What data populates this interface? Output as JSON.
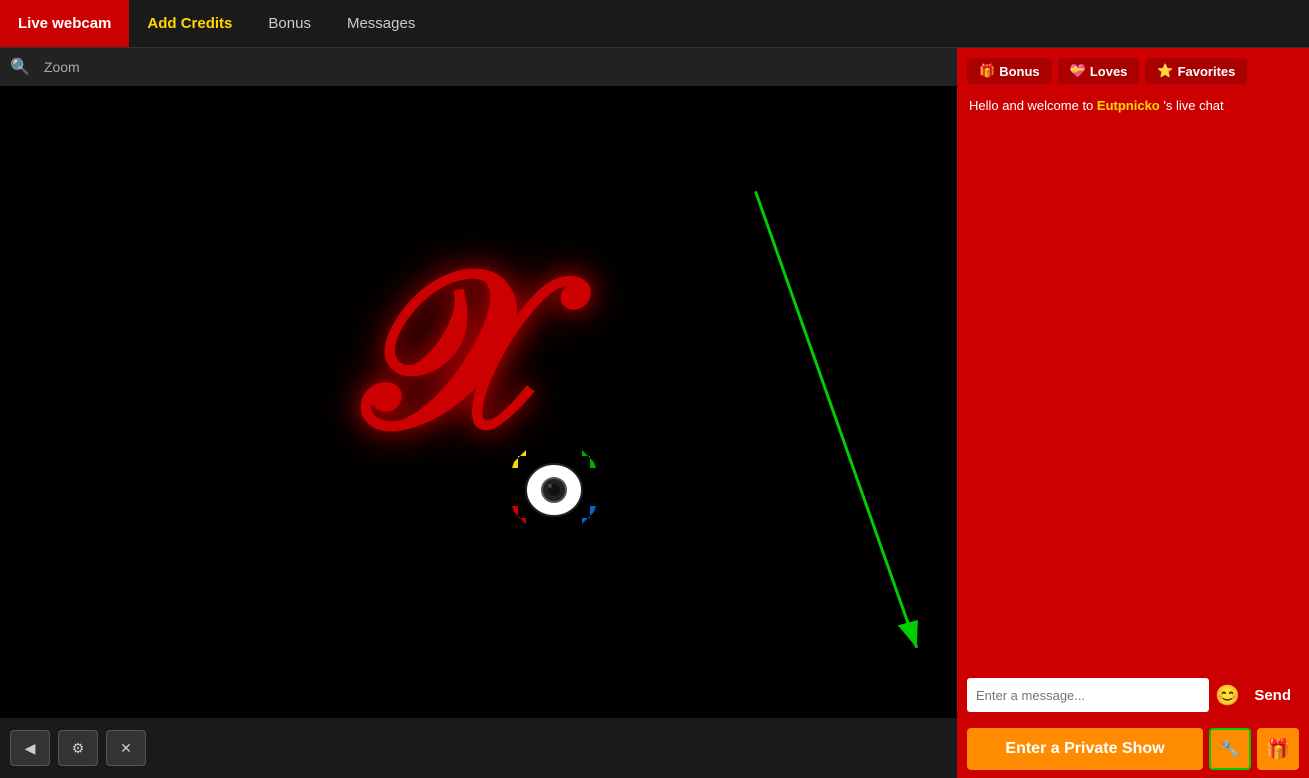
{
  "nav": {
    "items": [
      {
        "label": "Live webcam",
        "active": true,
        "highlight": false
      },
      {
        "label": "Add Credits",
        "active": false,
        "highlight": true
      },
      {
        "label": "Bonus",
        "active": false,
        "highlight": false
      },
      {
        "label": "Messages",
        "active": false,
        "highlight": false
      }
    ]
  },
  "toolbar": {
    "zoom_label": "Zoom",
    "search_icon": "🔍"
  },
  "sidebar": {
    "tabs": [
      {
        "label": "Bonus",
        "icon": "🎁"
      },
      {
        "label": "Loves",
        "icon": "💝"
      },
      {
        "label": "Favorites",
        "icon": "⭐"
      }
    ],
    "welcome_text": "Hello and welcome to ",
    "username": "Eutpnicko",
    "welcome_suffix": " 's live chat",
    "message_placeholder": "Enter a message..."
  },
  "chat_input": {
    "send_label": "Send",
    "emoji_icon": "😊",
    "placeholder": "Enter a message..."
  },
  "bottom_bar": {
    "private_show_label": "Enter a Private Show",
    "settings_icon": "⚙",
    "gift_icon": "🎁"
  },
  "video_controls": [
    {
      "icon": "◀",
      "name": "prev"
    },
    {
      "icon": "⚙",
      "name": "settings"
    },
    {
      "icon": "✕",
      "name": "close"
    }
  ]
}
